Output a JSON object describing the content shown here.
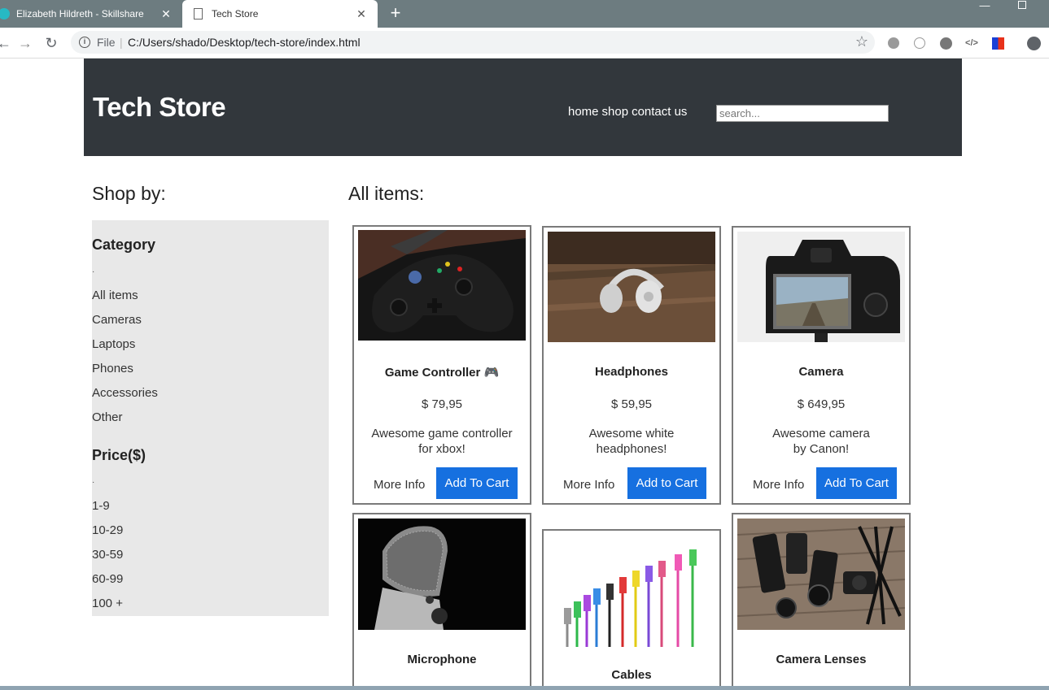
{
  "browser": {
    "tabs": [
      {
        "title": "Elizabeth Hildreth - Skillshare",
        "active": false
      },
      {
        "title": "Tech Store",
        "active": true
      }
    ],
    "address": {
      "scheme_label": "File",
      "url": "C:/Users/shado/Desktop/tech-store/index.html"
    }
  },
  "site": {
    "title": "Tech Store",
    "nav": [
      "home",
      "shop",
      "contact us"
    ],
    "search_placeholder": "search..."
  },
  "sidebar": {
    "heading": "Shop by:",
    "category_title": "Category",
    "categories": [
      "All items",
      "Cameras",
      "Laptops",
      "Phones",
      "Accessories",
      "Other"
    ],
    "price_title": "Price($)",
    "prices": [
      "1-9",
      "10-29",
      "30-59",
      "60-99",
      "100 +"
    ]
  },
  "main": {
    "heading": "All items:",
    "products": [
      {
        "name": "Game Controller 🎮",
        "price": "$ 79,95",
        "desc_1": "Awesome game controller",
        "desc_2": "for xbox!",
        "more": "More Info",
        "cart": "Add To Cart"
      },
      {
        "name": "Headphones",
        "price": "$ 59,95",
        "desc_1": "Awesome white",
        "desc_2": "headphones!",
        "more": "More Info",
        "cart": "Add to Cart"
      },
      {
        "name": "Camera",
        "price": "$ 649,95",
        "desc_1": "Awesome camera",
        "desc_2": "by Canon!",
        "more": "More Info",
        "cart": "Add To Cart"
      },
      {
        "name": "Microphone"
      },
      {
        "name": "Cables"
      },
      {
        "name": "Camera Lenses"
      }
    ]
  },
  "colors": {
    "header_bg": "#32373c",
    "sidebar_bg": "#e8e8e8",
    "button_blue": "#1670e0",
    "card_border": "#7a7a7a"
  }
}
